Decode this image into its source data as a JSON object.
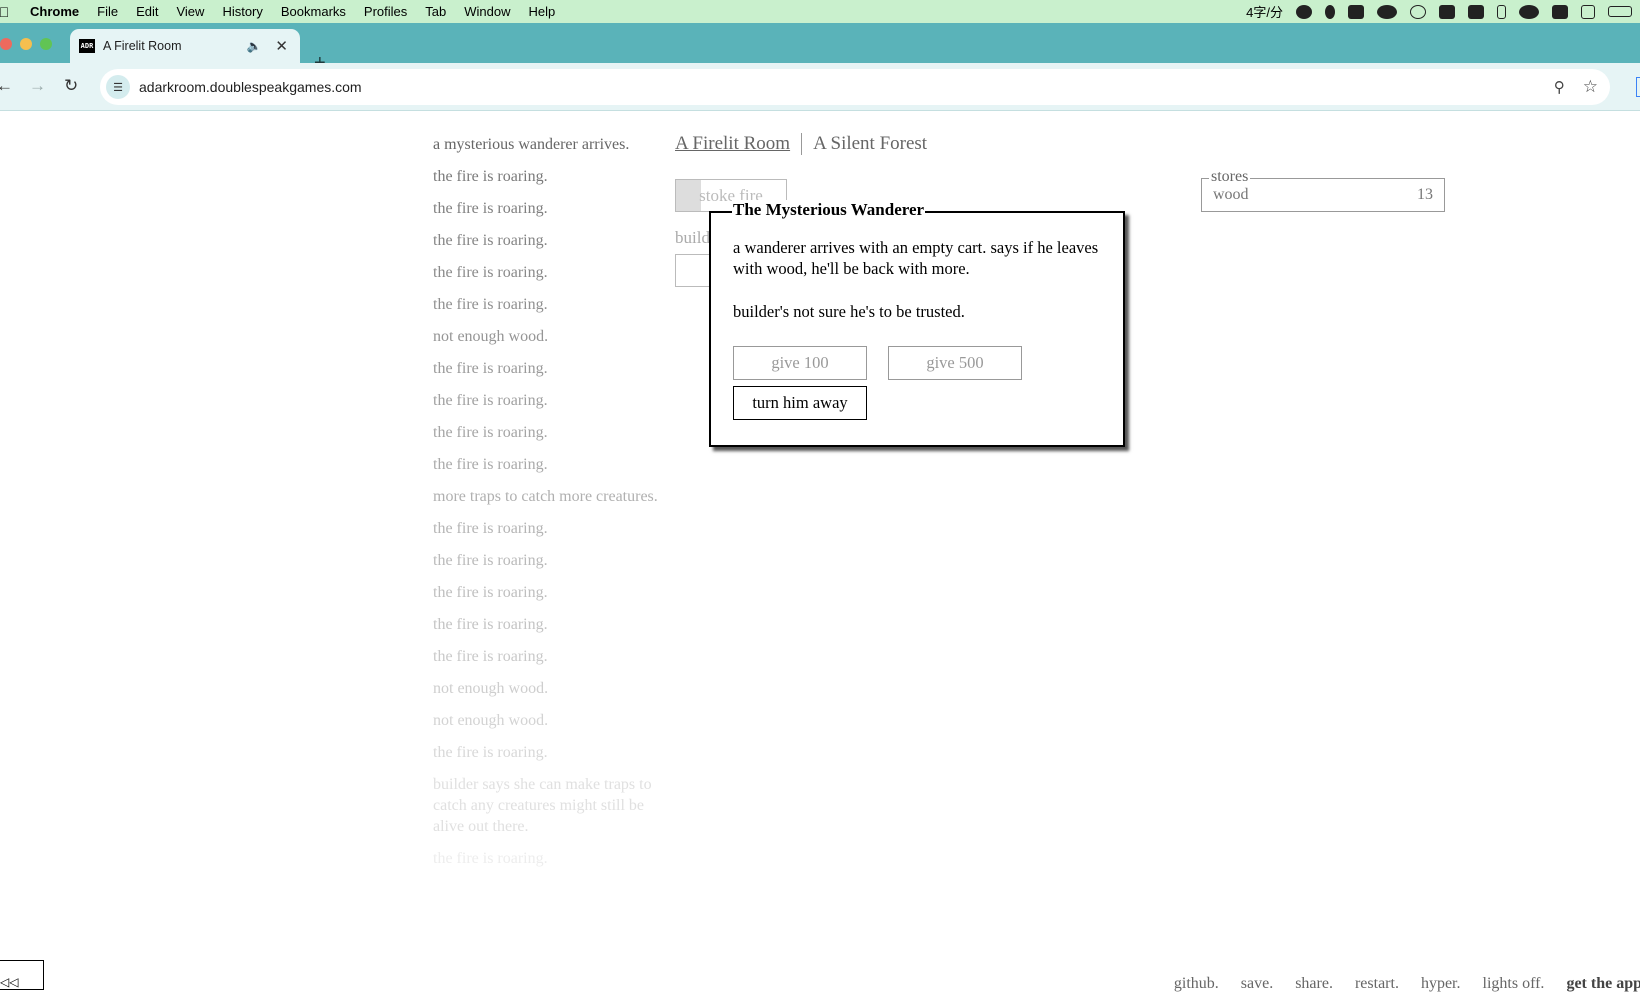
{
  "menubar": {
    "app": "Chrome",
    "items": [
      "File",
      "Edit",
      "View",
      "History",
      "Bookmarks",
      "Profiles",
      "Tab",
      "Window",
      "Help"
    ],
    "input_status": "4字/分"
  },
  "browser": {
    "tab_title": "A Firelit Room",
    "favicon_text": "ADR",
    "url": "adarkroom.doublespeakgames.com"
  },
  "notifications": [
    {
      "text": "a mysterious wanderer arrives.",
      "color": "#666666"
    },
    {
      "text": "the fire is roaring.",
      "color": "#7a7a7a"
    },
    {
      "text": "the fire is roaring.",
      "color": "#808080"
    },
    {
      "text": "the fire is roaring.",
      "color": "#858585"
    },
    {
      "text": "the fire is roaring.",
      "color": "#8a8a8a"
    },
    {
      "text": "the fire is roaring.",
      "color": "#909090"
    },
    {
      "text": "not enough wood.",
      "color": "#959595"
    },
    {
      "text": "the fire is roaring.",
      "color": "#9a9a9a"
    },
    {
      "text": "the fire is roaring.",
      "color": "#a0a0a0"
    },
    {
      "text": "the fire is roaring.",
      "color": "#a5a5a5"
    },
    {
      "text": "the fire is roaring.",
      "color": "#aaaaaa"
    },
    {
      "text": "more traps to catch more creatures.",
      "color": "#b0b0b0"
    },
    {
      "text": "the fire is roaring.",
      "color": "#b5b5b5"
    },
    {
      "text": "the fire is roaring.",
      "color": "#bababa"
    },
    {
      "text": "the fire is roaring.",
      "color": "#bfbfbf"
    },
    {
      "text": "the fire is roaring.",
      "color": "#c4c4c4"
    },
    {
      "text": "the fire is roaring.",
      "color": "#c9c9c9"
    },
    {
      "text": "not enough wood.",
      "color": "#cecece"
    },
    {
      "text": "not enough wood.",
      "color": "#d3d3d3"
    },
    {
      "text": "the fire is roaring.",
      "color": "#d8d8d8"
    },
    {
      "text": "builder says she can make traps to catch any creatures might still be alive out there.",
      "color": "#e0e0e0"
    },
    {
      "text": "the fire is roaring.",
      "color": "#ededed"
    }
  ],
  "header": {
    "room": "A Firelit Room",
    "forest": "A Silent Forest"
  },
  "room": {
    "stoke_label": "stoke fire",
    "builder_label": "builder"
  },
  "stores": {
    "legend": "stores",
    "wood_label": "wood",
    "wood_value": "13"
  },
  "event": {
    "title": "The Mysterious Wanderer",
    "text1": "a wanderer arrives with an empty cart. says if he leaves with wood, he'll be back with more.",
    "text2": "builder's not sure he's to be trusted.",
    "give100": "give 100",
    "give500": "give 500",
    "turn_away": "turn him away"
  },
  "footer": {
    "github": "github.",
    "save": "save.",
    "share": "share.",
    "restart": "restart.",
    "hyper": "hyper.",
    "lights": "lights off.",
    "app": "get the app."
  }
}
